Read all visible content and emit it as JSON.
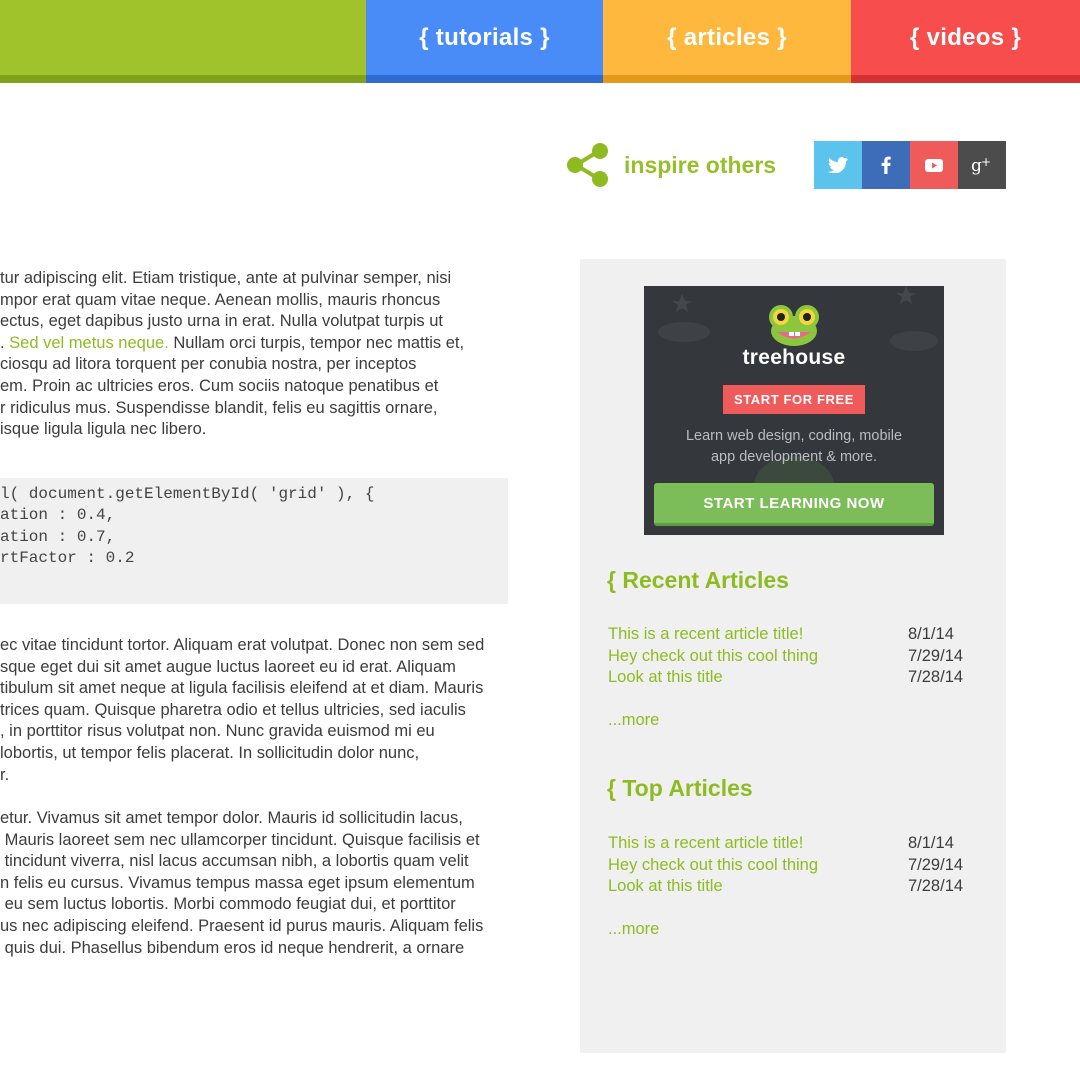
{
  "nav": {
    "tutorials": "{ tutorials }",
    "articles": "{ articles }",
    "videos": "{ videos }"
  },
  "share": {
    "label": "inspire others",
    "icon": "share-icon",
    "networks": [
      "twitter-icon",
      "facebook-icon",
      "youtube-icon",
      "google-plus-icon"
    ]
  },
  "content": {
    "p1_lines": [
      "tur adipiscing elit. Etiam tristique, ante at pulvinar semper, nisi",
      "mpor erat quam vitae neque. Aenean mollis, mauris rhoncus",
      "ectus, eget dapibus justo urna in erat. Nulla volutpat turpis ut"
    ],
    "p1_line4_pre": ". ",
    "p1_link": "Sed vel metus neque.",
    "p1_line4_post": " Nullam orci turpis, tempor nec mattis et,",
    "p1_lines_b": [
      "ciosqu ad litora torquent per conubia nostra, per inceptos",
      "em. Proin ac ultricies eros. Cum sociis natoque penatibus et",
      "r ridiculus mus. Suspendisse blandit, felis eu sagittis ornare,",
      "isque ligula ligula nec libero."
    ],
    "code_lines": [
      "l( document.getElementById( 'grid' ), {",
      "ation : 0.4,",
      "ation : 0.7,",
      "rtFactor : 0.2"
    ],
    "p2_lines": [
      "ec vitae tincidunt tortor. Aliquam erat volutpat. Donec non sem sed",
      "sque eget dui sit amet augue luctus laoreet eu id erat. Aliquam",
      "tibulum sit amet neque at ligula facilisis eleifend at et diam. Mauris",
      "trices quam. Quisque pharetra odio et tellus ultricies, sed iaculis",
      ", in porttitor risus volutpat non. Nunc gravida euismod mi eu",
      "lobortis, ut tempor felis placerat. In sollicitudin dolor nunc,",
      "r."
    ],
    "p3_lines": [
      "etur. Vivamus sit amet tempor dolor. Mauris id sollicitudin lacus,",
      " Mauris laoreet sem nec ullamcorper tincidunt. Quisque facilisis et",
      " tincidunt viverra, nisl lacus accumsan nibh, a lobortis quam velit",
      "n felis eu cursus. Vivamus tempus massa eget ipsum elementum",
      " eu sem luctus lobortis. Morbi commodo feugiat dui, et porttitor",
      "us nec adipiscing eleifend. Praesent id purus mauris. Aliquam felis",
      " quis dui. Phasellus bibendum eros id neque hendrerit, a ornare"
    ]
  },
  "ad": {
    "brand": "treehouse",
    "start_label": "START FOR FREE",
    "description": "Learn web design, coding, mobile\napp development & more.",
    "cta_label": "START LEARNING NOW"
  },
  "sidebar": {
    "recent": {
      "heading": "{ Recent Articles",
      "items": [
        {
          "title": "This is a recent article title!",
          "date": "8/1/14"
        },
        {
          "title": "Hey check out this cool thing",
          "date": "7/29/14"
        },
        {
          "title": "Look at this title",
          "date": "7/28/14"
        }
      ],
      "more": "...more"
    },
    "top": {
      "heading": "{ Top Articles",
      "items": [
        {
          "title": "This is a recent article title!",
          "date": "8/1/14"
        },
        {
          "title": "Hey check out this cool thing",
          "date": "7/29/14"
        },
        {
          "title": "Look at this title",
          "date": "7/28/14"
        }
      ],
      "more": "...more"
    }
  },
  "colors": {
    "green": "#a0c22b",
    "blue": "#4a8cf7",
    "orange": "#fdb83d",
    "red": "#f74d4d",
    "accent_text": "#8fbb22"
  }
}
